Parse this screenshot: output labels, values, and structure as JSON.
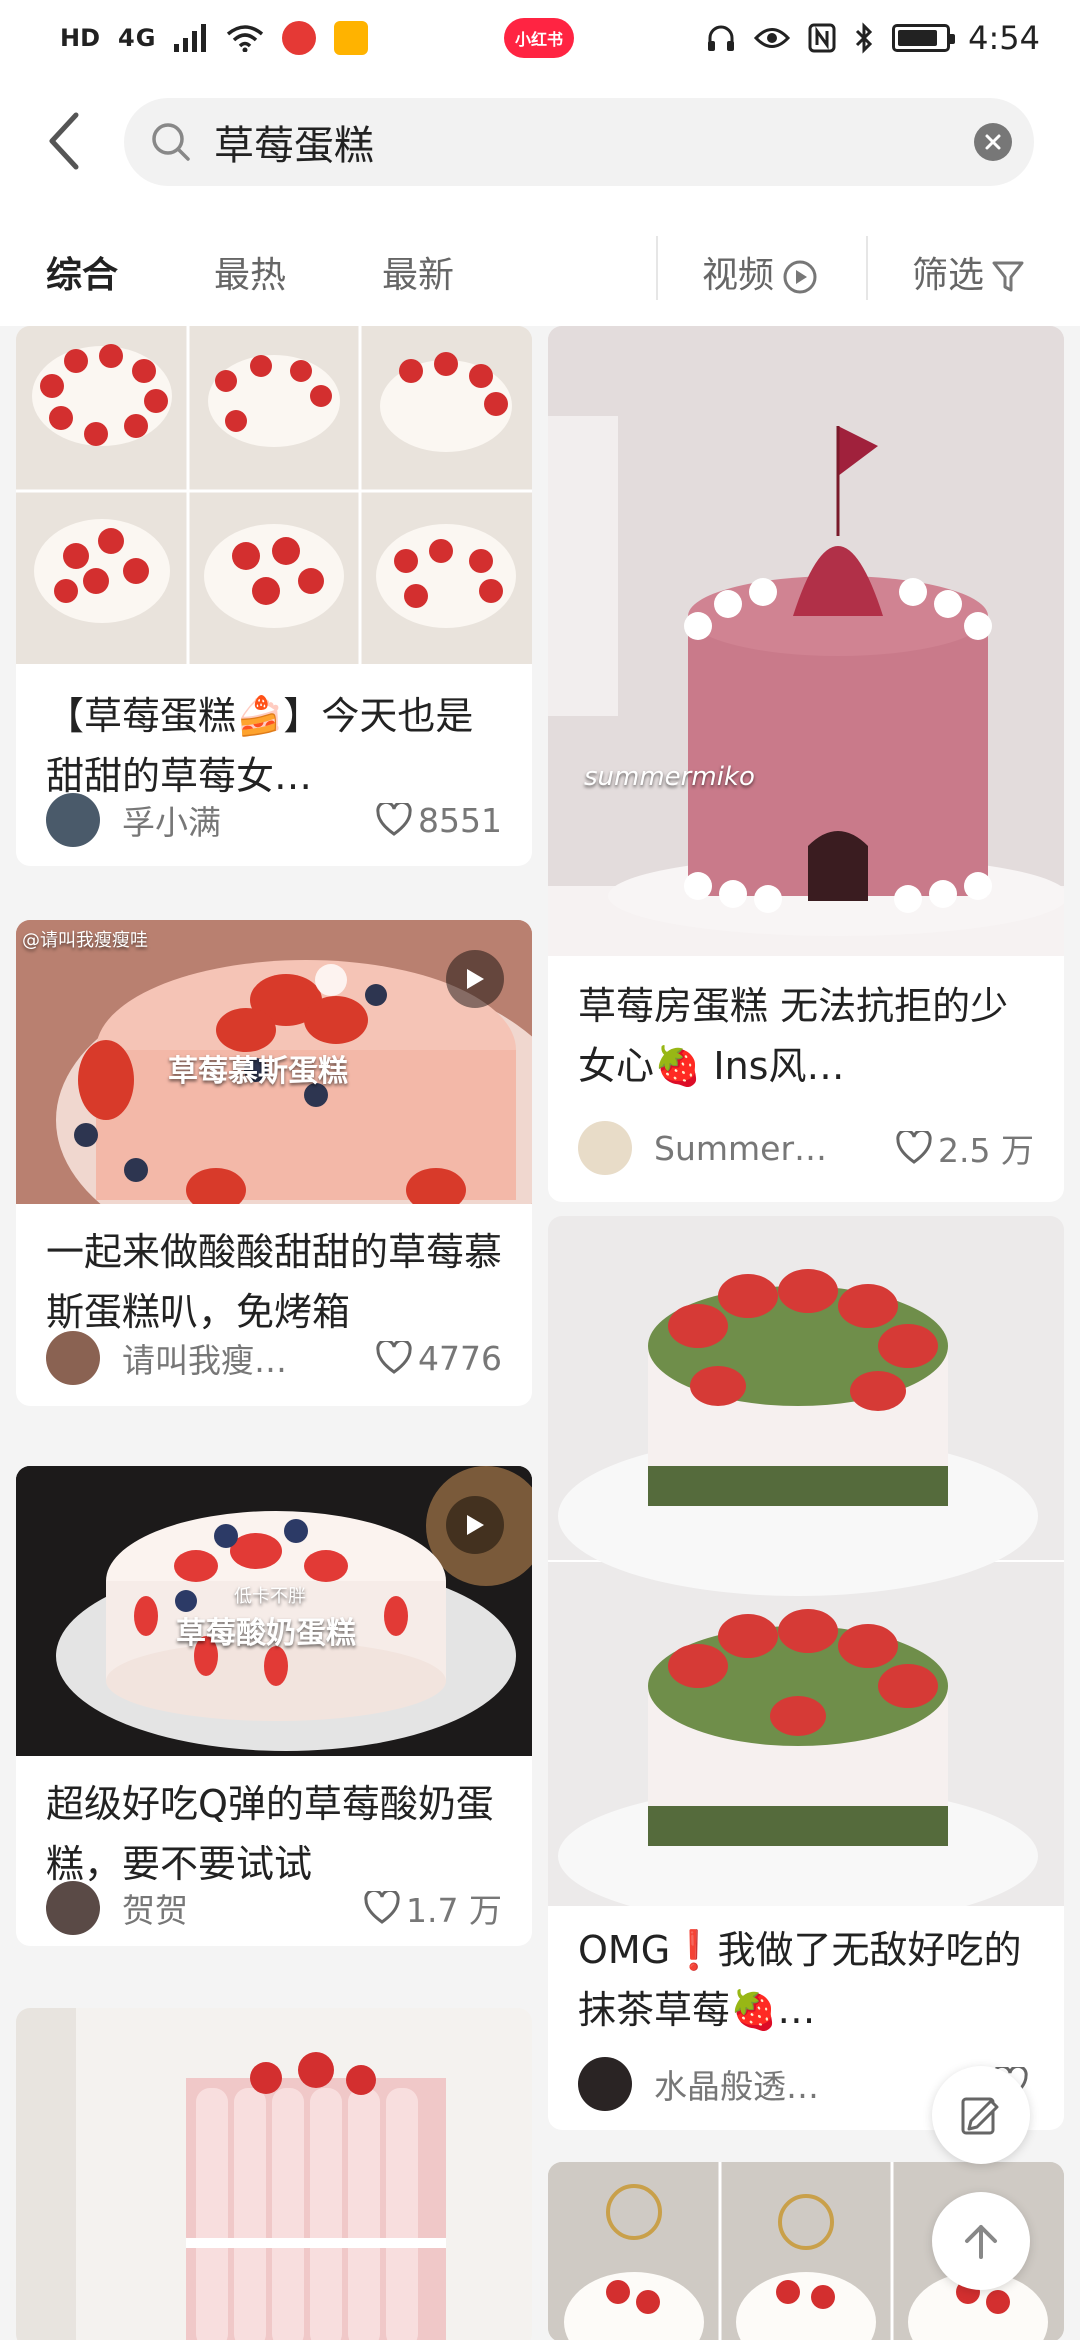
{
  "status_bar": {
    "network": "HD",
    "signal": "4G",
    "center_badge": "小红书",
    "time": "4:54",
    "battery_level": 0.85
  },
  "search": {
    "query": "草莓蛋糕"
  },
  "tabs": {
    "items": [
      "综合",
      "最热",
      "最新"
    ],
    "video": "视频",
    "filter": "筛选",
    "active": "综合"
  },
  "feed": {
    "left": [
      {
        "title": "【草莓蛋糕🍰】今天也是甜甜的草莓女…",
        "author": "孚小满",
        "likes": "8551",
        "is_video": false
      },
      {
        "title": "一起来做酸酸甜甜的草莓慕斯蛋糕叭，免烤箱",
        "author": "请叫我瘦…",
        "likes": "4776",
        "is_video": true,
        "image_label": "草莓慕斯蛋糕",
        "image_tag": "@请叫我瘦瘦哇"
      },
      {
        "title": "超级好吃Q弹的草莓酸奶蛋糕，要不要试试",
        "author": "贺贺",
        "likes": "1.7 万",
        "is_video": true,
        "image_label": "草莓酸奶蛋糕",
        "image_sub": "低卡不胖"
      },
      {
        "title": "",
        "author": "",
        "likes": "",
        "is_video": false
      }
    ],
    "right": [
      {
        "title": "草莓房蛋糕 无法抗拒的少女心🍓 Ins风…",
        "author": "Summer…",
        "likes": "2.5 万",
        "is_video": false,
        "image_label": "summermiko"
      },
      {
        "title": "OMG❗我做了无敌好吃的抹茶草莓🍓…",
        "author": "水晶般透…",
        "likes": "",
        "is_video": false
      },
      {
        "title": "",
        "author": "",
        "likes": "",
        "is_video": false
      }
    ]
  },
  "colors": {
    "accent": "#ff2442",
    "background": "#f4f4f4",
    "card": "#ffffff"
  }
}
